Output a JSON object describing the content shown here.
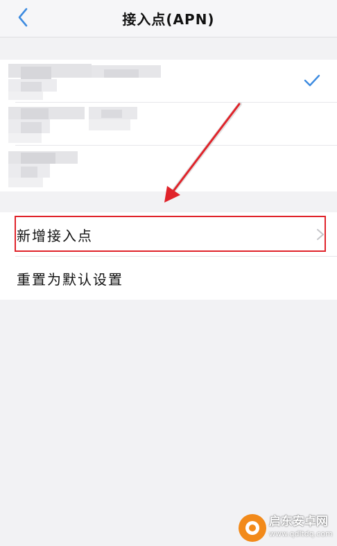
{
  "header": {
    "title": "接入点(APN)",
    "back_icon": "chevron-left-icon"
  },
  "apn_list": {
    "items": [
      {
        "selected": true,
        "check_icon": "check-icon"
      },
      {
        "selected": false
      },
      {
        "selected": false
      }
    ]
  },
  "actions": {
    "add_apn_label": "新增接入点",
    "reset_label": "重置为默认设置",
    "chevron_icon": "chevron-right-icon"
  },
  "watermark": {
    "title": "启东安卓网",
    "url": "www.qdltdq.com"
  },
  "colors": {
    "accent_blue": "#3d8be0",
    "highlight_red": "#e0232a",
    "background": "#f2f2f4",
    "watermark_orange": "#f28a1a"
  }
}
